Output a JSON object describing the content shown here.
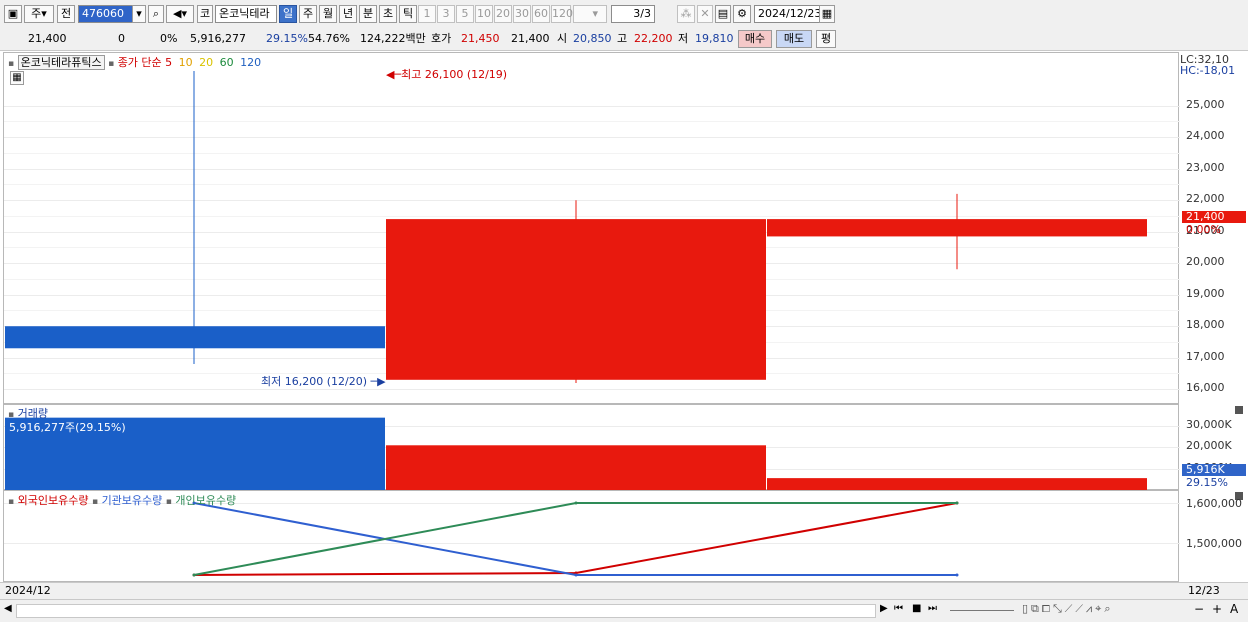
{
  "toolbar": {
    "market": "주",
    "prev_label": "전",
    "code": "476060",
    "ko_label": "코",
    "stock_name": "온코닉테라",
    "period_tabs": [
      "일",
      "주",
      "월",
      "년",
      "분",
      "초",
      "틱"
    ],
    "interval_buttons": [
      "1",
      "3",
      "5",
      "10",
      "20",
      "30",
      "60",
      "120"
    ],
    "page": "3/3",
    "date": "2024/12/23"
  },
  "quote": {
    "price": "21,400",
    "change": "0",
    "change_pct": "0%",
    "volume": "5,916,277",
    "turnover_pct": "29.15%",
    "ratio_pct": "54.76%",
    "trade_value": "124,222백만",
    "hoga_label": "호가",
    "hoga": "21,450",
    "hoga2": "21,400",
    "open_label": "시",
    "open": "20,850",
    "high_label": "고",
    "high": "22,200",
    "low_label": "저",
    "low": "19,810",
    "buy_label": "매수",
    "sell_label": "매도",
    "eval_label": "평"
  },
  "price_chart": {
    "stock_tag": "온코닉테라퓨틱스",
    "ma_label": "종가 단순",
    "ma_periods": [
      "5",
      "10",
      "20",
      "60",
      "120"
    ],
    "ma_colors": [
      "#d00000",
      "#e0a000",
      "#d9c300",
      "#1c8a3c",
      "#2060c0"
    ],
    "high_annotation": "최고 26,100 (12/19)",
    "low_annotation": "최저 16,200 (12/20)",
    "lc": "LC:32,10",
    "hc": "HC:-18,01",
    "y_ticks": [
      "25,000",
      "24,000",
      "23,000",
      "22,000",
      "21,000",
      "20,000",
      "19,000",
      "18,000",
      "17,000",
      "16,000"
    ],
    "last_price_tag": "21,400",
    "last_change_tag": "0.00%"
  },
  "volume_chart": {
    "title": "거래량",
    "label": "5,916,277주(29.15%)",
    "y_ticks": [
      "30,000K",
      "20,000K",
      "10,000K"
    ],
    "last_tag": "5,916K",
    "last_pct": "29.15%"
  },
  "holding_chart": {
    "legend": [
      "외국인보유수량",
      "기관보유수량",
      "개인보유수량"
    ],
    "colors": [
      "#d00000",
      "#2f5fd0",
      "#2e8b57"
    ],
    "y_ticks": [
      "1,600,000",
      "1,500,000"
    ]
  },
  "x_axis": {
    "left_label": "2024/12",
    "right_label": "12/23"
  },
  "chart_data": {
    "type": "candlestick",
    "dates": [
      "12/19",
      "12/20",
      "12/23"
    ],
    "candles": [
      {
        "date": "12/19",
        "open": 18000,
        "high": 26100,
        "low": 16800,
        "close": 17300,
        "color": "#1a5fc8"
      },
      {
        "date": "12/20",
        "open": 16300,
        "high": 22000,
        "low": 16200,
        "close": 21400,
        "color": "#e8190e"
      },
      {
        "date": "12/23",
        "open": 20850,
        "high": 22200,
        "low": 19810,
        "close": 21400,
        "color": "#e8190e"
      }
    ],
    "y_range": [
      15500,
      26100
    ],
    "volume": [
      {
        "date": "12/19",
        "value": 33700000,
        "color": "#1a5fc8"
      },
      {
        "date": "12/20",
        "value": 21000000,
        "color": "#e8190e"
      },
      {
        "date": "12/23",
        "value": 5916277,
        "color": "#e8190e"
      }
    ],
    "volume_range": [
      0,
      34000000
    ],
    "holdings": [
      {
        "name": "외국인보유수량",
        "color": "#d00000",
        "values": [
          1420000,
          1425000,
          1600000
        ]
      },
      {
        "name": "기관보유수량",
        "color": "#2f5fd0",
        "values": [
          1600000,
          1420000,
          1420000
        ]
      },
      {
        "name": "개인보유수량",
        "color": "#2e8b57",
        "values": [
          1420000,
          1600000,
          1600000
        ]
      }
    ],
    "holdings_range": [
      1415000,
      1615000
    ]
  }
}
